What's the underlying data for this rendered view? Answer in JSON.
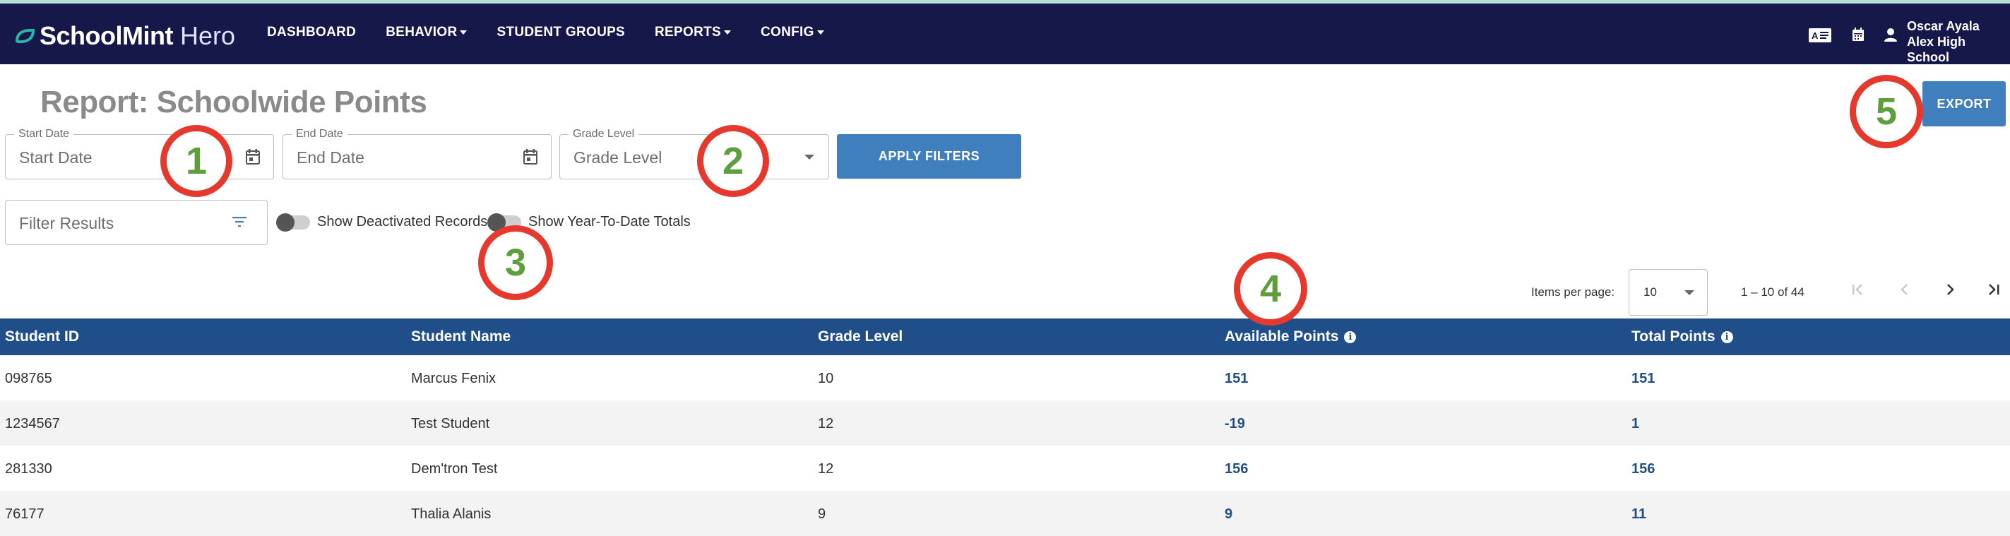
{
  "navbar": {
    "brand": "SchoolMint",
    "product": "Hero",
    "items": [
      {
        "label": "DASHBOARD",
        "dropdown": false
      },
      {
        "label": "BEHAVIOR",
        "dropdown": true
      },
      {
        "label": "STUDENT GROUPS",
        "dropdown": false
      },
      {
        "label": "REPORTS",
        "dropdown": true
      },
      {
        "label": "CONFIG",
        "dropdown": true
      }
    ],
    "icons": [
      "id-card-icon",
      "calendar-icon",
      "user-icon"
    ],
    "user": {
      "name": "Oscar Ayala",
      "school": "Alex High School"
    }
  },
  "page": {
    "title": "Report: Schoolwide Points",
    "export_label": "EXPORT"
  },
  "filters": {
    "start_date": {
      "label": "Start Date",
      "placeholder": "Start Date"
    },
    "end_date": {
      "label": "End Date",
      "placeholder": "End Date"
    },
    "grade_level": {
      "label": "Grade Level",
      "placeholder": "Grade Level"
    },
    "apply_label": "APPLY FILTERS",
    "search_placeholder": "Filter Results",
    "toggles": [
      {
        "label": "Show Deactivated Records",
        "on": false
      },
      {
        "label": "Show Year-To-Date Totals",
        "on": false
      }
    ]
  },
  "pagination": {
    "items_per_page_label": "Items per page:",
    "items_per_page": "10",
    "range": "1 – 10 of 44"
  },
  "table": {
    "columns": [
      "Student ID",
      "Student Name",
      "Grade Level",
      "Available Points",
      "Total Points"
    ],
    "rows": [
      [
        "098765",
        "Marcus Fenix",
        "10",
        "151",
        "151"
      ],
      [
        "1234567",
        "Test Student",
        "12",
        "-19",
        "1"
      ],
      [
        "281330",
        "Dem'tron Test",
        "12",
        "156",
        "156"
      ],
      [
        "76177",
        "Thalia Alanis",
        "9",
        "9",
        "11"
      ]
    ]
  },
  "callouts": [
    "1",
    "2",
    "3",
    "4",
    "5"
  ],
  "colors": {
    "navbar": "#17184a",
    "accent": "#3f7fbe",
    "table_header": "#1f4e88",
    "callout_ring": "#e5392e",
    "callout_text": "#5e9e3c"
  }
}
